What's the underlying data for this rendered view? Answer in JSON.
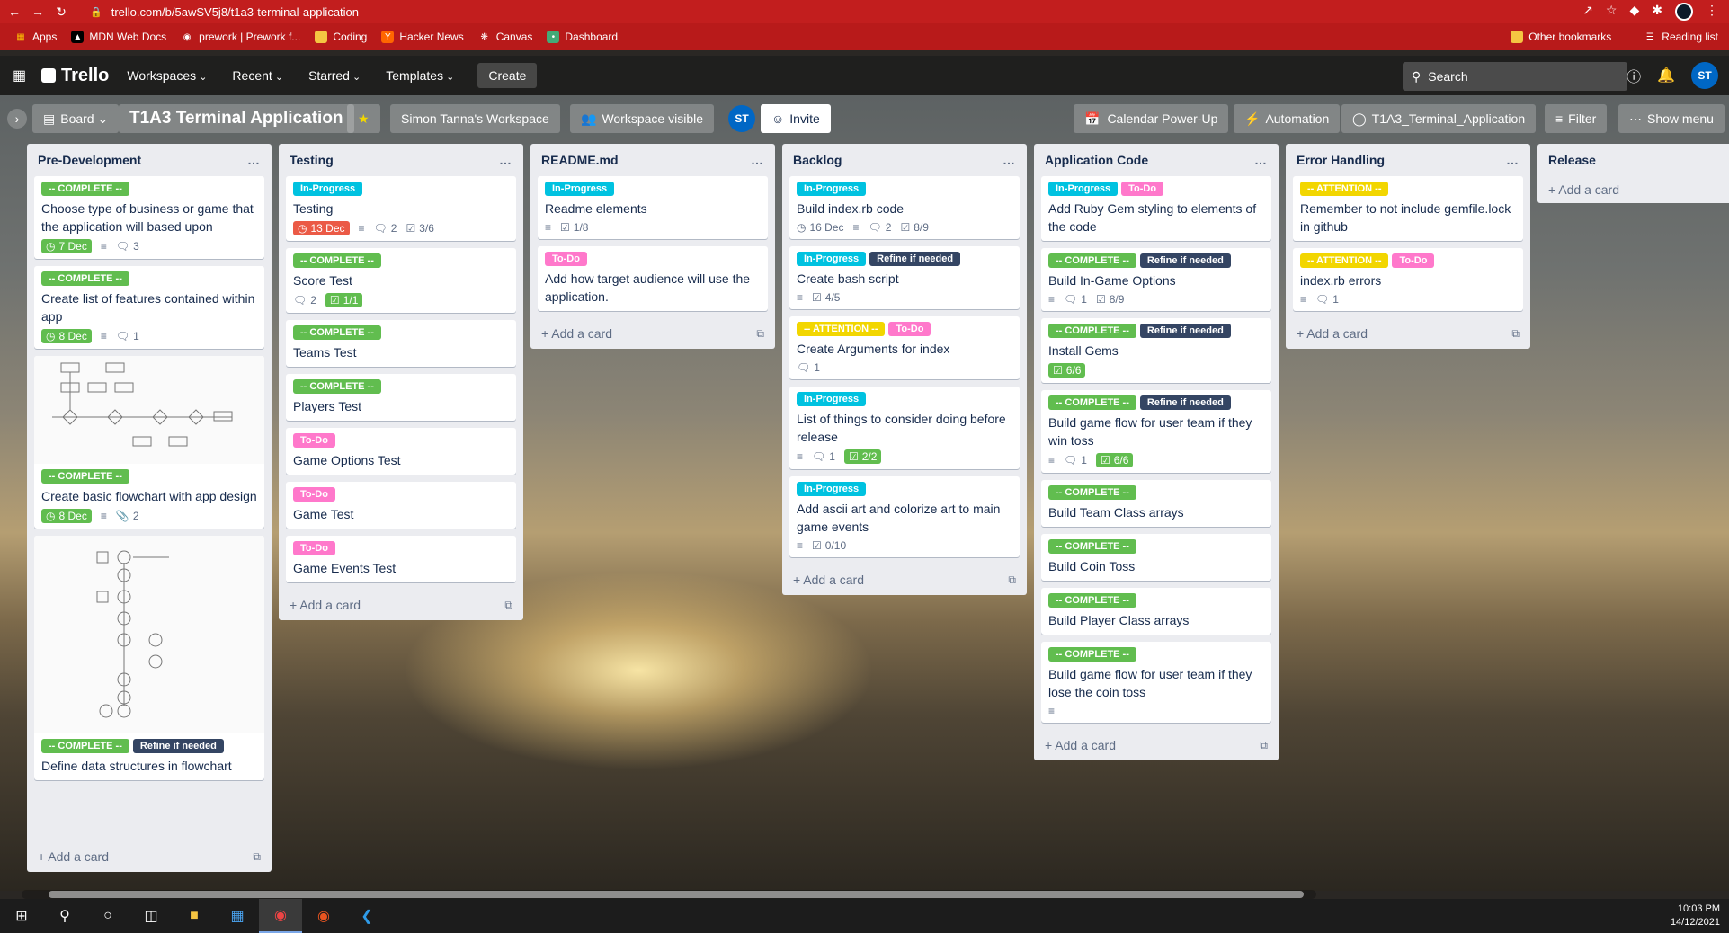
{
  "browser": {
    "url": "trello.com/b/5awSV5j8/t1a3-terminal-application",
    "bookmarks": [
      "Apps",
      "MDN Web Docs",
      "prework | Prework f...",
      "Coding",
      "Hacker News",
      "Canvas",
      "Dashboard"
    ],
    "bookmarks_right": [
      "Other bookmarks",
      "Reading list"
    ]
  },
  "trello": {
    "logo": "Trello",
    "menu": [
      "Workspaces",
      "Recent",
      "Starred",
      "Templates"
    ],
    "create": "Create",
    "search_placeholder": "Search",
    "avatar": "ST"
  },
  "board": {
    "view": "Board",
    "title": "T1A3 Terminal Application",
    "workspace": "Simon Tanna's Workspace",
    "visibility": "Workspace visible",
    "member": "ST",
    "invite": "Invite",
    "calendar": "Calendar Power-Up",
    "automation": "Automation",
    "github": "T1A3_Terminal_Application",
    "filter": "Filter",
    "show_menu": "Show menu"
  },
  "add_card": "Add a card",
  "lists": [
    {
      "title": "Pre-Development",
      "cards": [
        {
          "labels": [
            {
              "t": "-- COMPLETE --",
              "c": "green"
            }
          ],
          "title": "Choose type of business or game that the application will based upon",
          "due": "7 Dec",
          "desc": true,
          "comments": "3"
        },
        {
          "labels": [
            {
              "t": "-- COMPLETE --",
              "c": "green"
            }
          ],
          "title": "Create list of features contained within app",
          "due": "8 Dec",
          "desc": true,
          "comments": "1"
        },
        {
          "image": "flowchart",
          "labels": [
            {
              "t": "-- COMPLETE --",
              "c": "green"
            }
          ],
          "title": "Create basic flowchart with app design",
          "due": "8 Dec",
          "desc": true,
          "attachments": "2"
        },
        {
          "image": "data-flow",
          "labels": [
            {
              "t": "-- COMPLETE --",
              "c": "green"
            },
            {
              "t": "Refine if needed",
              "c": "dark"
            }
          ],
          "title": "Define data structures in flowchart"
        }
      ]
    },
    {
      "title": "Testing",
      "cards": [
        {
          "labels": [
            {
              "t": "In-Progress",
              "c": "blue"
            }
          ],
          "title": "Testing",
          "due_red": "13 Dec",
          "desc": true,
          "comments": "2",
          "checklist": "3/6"
        },
        {
          "labels": [
            {
              "t": "-- COMPLETE --",
              "c": "green"
            }
          ],
          "title": "Score Test",
          "comments": "2",
          "checklist_done": "1/1"
        },
        {
          "labels": [
            {
              "t": "-- COMPLETE --",
              "c": "green"
            }
          ],
          "title": "Teams Test"
        },
        {
          "labels": [
            {
              "t": "-- COMPLETE --",
              "c": "green"
            }
          ],
          "title": "Players Test"
        },
        {
          "labels": [
            {
              "t": "To-Do",
              "c": "pink"
            }
          ],
          "title": "Game Options Test"
        },
        {
          "labels": [
            {
              "t": "To-Do",
              "c": "pink"
            }
          ],
          "title": "Game Test"
        },
        {
          "labels": [
            {
              "t": "To-Do",
              "c": "pink"
            }
          ],
          "title": "Game Events Test"
        }
      ]
    },
    {
      "title": "README.md",
      "cards": [
        {
          "labels": [
            {
              "t": "In-Progress",
              "c": "blue"
            }
          ],
          "title": "Readme elements",
          "desc": true,
          "checklist": "1/8"
        },
        {
          "labels": [
            {
              "t": "To-Do",
              "c": "pink"
            }
          ],
          "title": "Add how target audience will use the application."
        }
      ]
    },
    {
      "title": "Backlog",
      "cards": [
        {
          "labels": [
            {
              "t": "In-Progress",
              "c": "blue"
            }
          ],
          "title": "Build index.rb code",
          "due_plain": "16 Dec",
          "desc": true,
          "comments": "2",
          "checklist": "8/9"
        },
        {
          "labels": [
            {
              "t": "In-Progress",
              "c": "blue"
            },
            {
              "t": "Refine if needed",
              "c": "dark"
            }
          ],
          "title": "Create bash script",
          "desc": true,
          "checklist": "4/5"
        },
        {
          "labels": [
            {
              "t": "-- ATTENTION --",
              "c": "yellow"
            },
            {
              "t": "To-Do",
              "c": "pink"
            }
          ],
          "title": "Create Arguments for index",
          "comments": "1"
        },
        {
          "labels": [
            {
              "t": "In-Progress",
              "c": "blue"
            }
          ],
          "title": "List of things to consider doing before release",
          "desc": true,
          "comments": "1",
          "checklist_done": "2/2"
        },
        {
          "labels": [
            {
              "t": "In-Progress",
              "c": "blue"
            }
          ],
          "title": "Add ascii art and colorize art to main game events",
          "desc": true,
          "checklist": "0/10"
        }
      ]
    },
    {
      "title": "Application Code",
      "cards": [
        {
          "labels": [
            {
              "t": "In-Progress",
              "c": "blue"
            },
            {
              "t": "To-Do",
              "c": "pink"
            }
          ],
          "title": "Add Ruby Gem styling to elements of the code"
        },
        {
          "labels": [
            {
              "t": "-- COMPLETE --",
              "c": "green"
            },
            {
              "t": "Refine if needed",
              "c": "dark"
            }
          ],
          "title": "Build In-Game Options",
          "desc": true,
          "comments": "1",
          "checklist": "8/9"
        },
        {
          "labels": [
            {
              "t": "-- COMPLETE --",
              "c": "green"
            },
            {
              "t": "Refine if needed",
              "c": "dark"
            }
          ],
          "title": "Install Gems",
          "checklist_done": "6/6"
        },
        {
          "labels": [
            {
              "t": "-- COMPLETE --",
              "c": "green"
            },
            {
              "t": "Refine if needed",
              "c": "dark"
            }
          ],
          "title": "Build game flow for user team if they win toss",
          "desc": true,
          "comments": "1",
          "checklist_done": "6/6"
        },
        {
          "labels": [
            {
              "t": "-- COMPLETE --",
              "c": "green"
            }
          ],
          "title": "Build Team Class arrays"
        },
        {
          "labels": [
            {
              "t": "-- COMPLETE --",
              "c": "green"
            }
          ],
          "title": "Build Coin Toss"
        },
        {
          "labels": [
            {
              "t": "-- COMPLETE --",
              "c": "green"
            }
          ],
          "title": "Build Player Class arrays"
        },
        {
          "labels": [
            {
              "t": "-- COMPLETE --",
              "c": "green"
            }
          ],
          "title": "Build game flow for user team if they lose the coin toss",
          "desc": true
        }
      ]
    },
    {
      "title": "Error Handling",
      "cards": [
        {
          "labels": [
            {
              "t": "-- ATTENTION --",
              "c": "yellow"
            }
          ],
          "title": "Remember to not include gemfile.lock in github"
        },
        {
          "labels": [
            {
              "t": "-- ATTENTION --",
              "c": "yellow"
            },
            {
              "t": "To-Do",
              "c": "pink"
            }
          ],
          "title": "index.rb errors",
          "desc": true,
          "comments": "1"
        }
      ]
    },
    {
      "title": "Release",
      "cards": []
    }
  ],
  "taskbar": {
    "time": "10:03 PM",
    "date": "14/12/2021"
  },
  "colors": {
    "chrome": "#c21e1e",
    "green": "#61bd4f",
    "blue": "#00c2e0",
    "pink": "#ff78cb",
    "yellow": "#f2d600",
    "dark": "#344563",
    "red": "#eb5a46"
  }
}
